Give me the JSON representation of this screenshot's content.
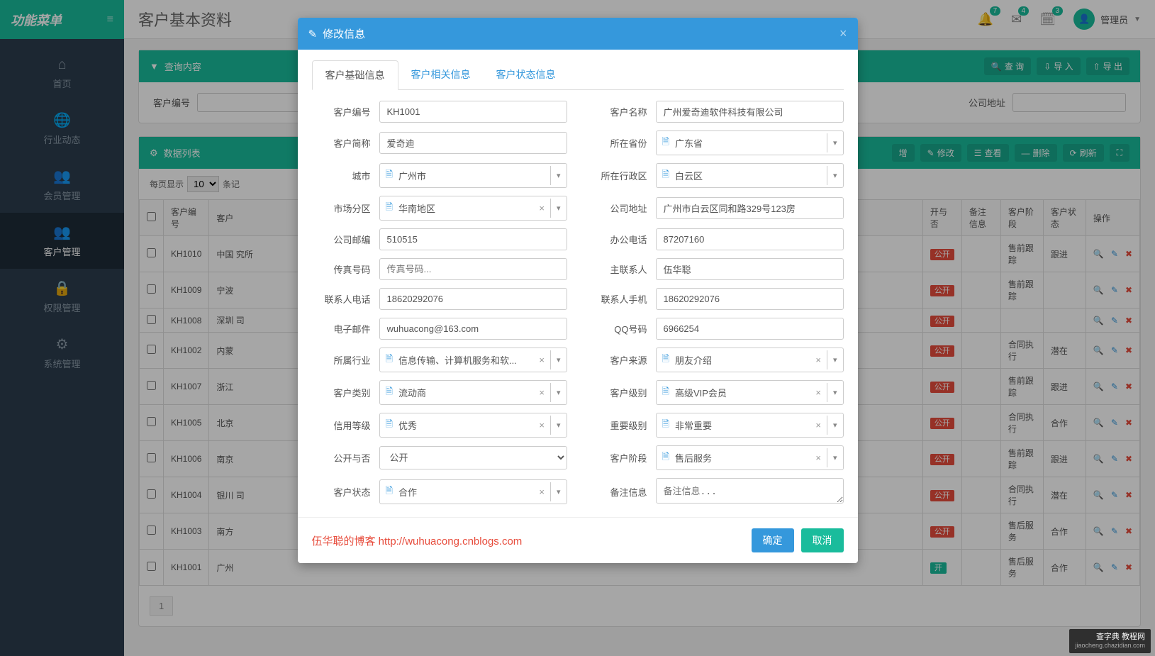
{
  "sidebar": {
    "title": "功能菜单",
    "items": [
      {
        "icon": "⌂",
        "label": "首页"
      },
      {
        "icon": "🌐",
        "label": "行业动态"
      },
      {
        "icon": "👥",
        "label": "会员管理"
      },
      {
        "icon": "👥",
        "label": "客户管理"
      },
      {
        "icon": "🔒",
        "label": "权限管理"
      },
      {
        "icon": "⚙",
        "label": "系统管理"
      }
    ]
  },
  "topbar": {
    "page_title": "客户基本资料",
    "notif_counts": [
      "7",
      "4",
      "3"
    ],
    "user_role": "管理员"
  },
  "query_panel": {
    "title": "查询内容",
    "fields": {
      "f1_label": "客户编号",
      "f2_label": "公司地址"
    },
    "buttons": {
      "search": "查 询",
      "import": "导 入",
      "export": "导 出"
    }
  },
  "list_panel": {
    "title": "数据列表",
    "toolbar": {
      "add": "增",
      "edit": "修改",
      "view": "查看",
      "delete": "删除",
      "refresh": "刷新"
    },
    "per_page_prefix": "每页显示",
    "per_page_value": "10",
    "per_page_suffix": "条记",
    "headers": {
      "code": "客户编号",
      "name": "客户",
      "open_col": "开与否",
      "remark": "备注信息",
      "stage": "客户阶段",
      "status": "客户状态",
      "ops": "操作"
    },
    "rows": [
      {
        "code": "KH1010",
        "name": "中国 究所",
        "open": "公开",
        "open_cls": "red",
        "stage": "售前跟踪",
        "status": "跟进"
      },
      {
        "code": "KH1009",
        "name": "宁波",
        "open": "公开",
        "open_cls": "red",
        "stage": "售前跟踪",
        "status": ""
      },
      {
        "code": "KH1008",
        "name": "深圳 司",
        "open": "公开",
        "open_cls": "red",
        "stage": "",
        "status": ""
      },
      {
        "code": "KH1002",
        "name": "内蒙",
        "open": "公开",
        "open_cls": "red",
        "stage": "合同执行",
        "status": "潜在"
      },
      {
        "code": "KH1007",
        "name": "浙江",
        "open": "公开",
        "open_cls": "red",
        "stage": "售前跟踪",
        "status": "跟进"
      },
      {
        "code": "KH1005",
        "name": "北京",
        "open": "公开",
        "open_cls": "red",
        "stage": "合同执行",
        "status": "合作"
      },
      {
        "code": "KH1006",
        "name": "南京",
        "open": "公开",
        "open_cls": "red",
        "stage": "售前跟踪",
        "status": "跟进"
      },
      {
        "code": "KH1004",
        "name": "银川 司",
        "open": "公开",
        "open_cls": "red",
        "stage": "合同执行",
        "status": "潜在"
      },
      {
        "code": "KH1003",
        "name": "南方",
        "open": "公开",
        "open_cls": "red",
        "stage": "售后服务",
        "status": "合作"
      },
      {
        "code": "KH1001",
        "name": "广州",
        "open": "开",
        "open_cls": "green",
        "stage": "售后服务",
        "status": "合作"
      }
    ],
    "page": "1"
  },
  "modal": {
    "title": "修改信息",
    "tabs": [
      "客户基础信息",
      "客户相关信息",
      "客户状态信息"
    ],
    "fields": {
      "code": {
        "label": "客户编号",
        "value": "KH1001",
        "type": "input"
      },
      "name": {
        "label": "客户名称",
        "value": "广州爱奇迪软件科技有限公司",
        "type": "input"
      },
      "short": {
        "label": "客户简称",
        "value": "爱奇迪",
        "type": "input"
      },
      "province": {
        "label": "所在省份",
        "value": "广东省",
        "type": "select_simple"
      },
      "city": {
        "label": "城市",
        "value": "广州市",
        "type": "select_simple"
      },
      "district": {
        "label": "所在行政区",
        "value": "白云区",
        "type": "select_simple"
      },
      "region": {
        "label": "市场分区",
        "value": "华南地区",
        "type": "select_clear"
      },
      "address": {
        "label": "公司地址",
        "value": "广州市白云区同和路329号123房",
        "type": "input"
      },
      "zip": {
        "label": "公司邮编",
        "value": "510515",
        "type": "input"
      },
      "tel": {
        "label": "办公电话",
        "value": "87207160",
        "type": "input"
      },
      "fax": {
        "label": "传真号码",
        "value": "",
        "placeholder": "传真号码...",
        "type": "input"
      },
      "contact": {
        "label": "主联系人",
        "value": "伍华聪",
        "type": "input"
      },
      "ctel": {
        "label": "联系人电话",
        "value": "18620292076",
        "type": "input"
      },
      "mobile": {
        "label": "联系人手机",
        "value": "18620292076",
        "type": "input"
      },
      "email": {
        "label": "电子邮件",
        "value": "wuhuacong@163.com",
        "type": "input"
      },
      "qq": {
        "label": "QQ号码",
        "value": "6966254",
        "type": "input"
      },
      "industry": {
        "label": "所属行业",
        "value": "信息传输、计算机服务和软...",
        "type": "select_clear"
      },
      "source": {
        "label": "客户来源",
        "value": "朋友介绍",
        "type": "select_clear"
      },
      "ctype": {
        "label": "客户类别",
        "value": "流动商",
        "type": "select_clear"
      },
      "level": {
        "label": "客户级别",
        "value": "高级VIP会员",
        "type": "select_clear"
      },
      "credit": {
        "label": "信用等级",
        "value": "优秀",
        "type": "select_clear"
      },
      "important": {
        "label": "重要级别",
        "value": "非常重要",
        "type": "select_clear"
      },
      "public": {
        "label": "公开与否",
        "value": "公开",
        "type": "native_select"
      },
      "stage": {
        "label": "客户阶段",
        "value": "售后服务",
        "type": "select_clear"
      },
      "cstatus": {
        "label": "客户状态",
        "value": "合作",
        "type": "select_clear"
      },
      "remark": {
        "label": "备注信息",
        "value": "",
        "placeholder": "备注信息...",
        "type": "textarea"
      }
    },
    "field_order_left": [
      "code",
      "short",
      "city",
      "region",
      "zip",
      "fax",
      "ctel",
      "email",
      "industry",
      "ctype",
      "credit",
      "public",
      "cstatus"
    ],
    "field_order_right": [
      "name",
      "province",
      "district",
      "address",
      "tel",
      "contact",
      "mobile",
      "qq",
      "source",
      "level",
      "important",
      "stage",
      "remark"
    ],
    "footer": {
      "blog_text": "伍华聪的博客  http://wuhuacong.cnblogs.com",
      "ok": "确定",
      "cancel": "取消"
    }
  },
  "watermark": {
    "main": "查字典 教程网",
    "sub": "jiaocheng.chazidian.com"
  }
}
